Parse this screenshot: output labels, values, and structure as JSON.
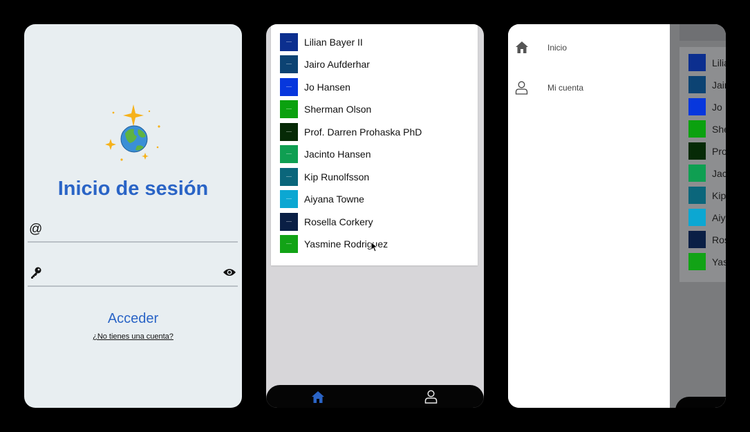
{
  "login": {
    "title": "Inicio de sesión",
    "email_icon": "@",
    "email_value": "",
    "password_value": "",
    "submit_label": "Acceder",
    "signup_link": "¿No tienes una cuenta?",
    "icons": [
      "globe-sparkles-icon",
      "key-icon",
      "eye-icon"
    ],
    "accent_color": "#2a64c6"
  },
  "list": {
    "items": [
      {
        "name": "Lilian Bayer II",
        "color": "#0c2f8f"
      },
      {
        "name": "Jairo Aufderhar",
        "color": "#0c4373"
      },
      {
        "name": "Jo Hansen",
        "color": "#0737dd"
      },
      {
        "name": "Sherman Olson",
        "color": "#0ba10f"
      },
      {
        "name": "Prof. Darren Prohaska PhD",
        "color": "#062a06"
      },
      {
        "name": "Jacinto Hansen",
        "color": "#0f9f52"
      },
      {
        "name": "Kip Runolfsson",
        "color": "#0b667b"
      },
      {
        "name": "Aiyana Towne",
        "color": "#0ca7d2"
      },
      {
        "name": "Rosella Corkery",
        "color": "#0a1f45"
      },
      {
        "name": "Yasmine Rodriguez",
        "color": "#12a316"
      }
    ],
    "tabs": [
      {
        "icon": "home-icon",
        "active": true
      },
      {
        "icon": "user-icon",
        "active": false
      }
    ],
    "active_color": "#2a64c6"
  },
  "drawer": {
    "items": [
      {
        "label": "Inicio",
        "icon": "home-icon"
      },
      {
        "label": "Mi cuenta",
        "icon": "user-icon"
      }
    ],
    "peek_names": [
      "Lilia",
      "Jair",
      "Jo",
      "She",
      "Pro",
      "Jac",
      "Kip",
      "Aiy",
      "Ros",
      "Yas"
    ],
    "peek_colors": [
      "#0c2f8f",
      "#0c4373",
      "#0737dd",
      "#0ba10f",
      "#062a06",
      "#0f9f52",
      "#0b667b",
      "#0ca7d2",
      "#0a1f45",
      "#12a316"
    ]
  }
}
